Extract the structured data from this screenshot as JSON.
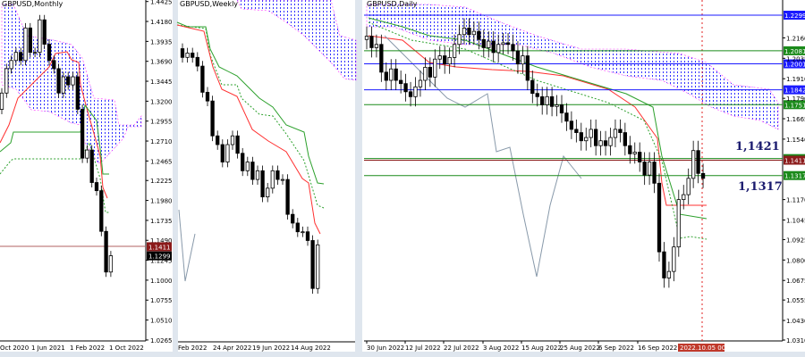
{
  "chart_data": [
    {
      "type": "candlestick",
      "title": "GBPUSD,Monthly",
      "y_ticks": [
        "1.4425",
        "1.4180",
        "1.3935",
        "1.3690",
        "1.3445",
        "1.3200",
        "1.2955",
        "1.2710",
        "1.2465",
        "1.2225",
        "1.1980",
        "1.1735",
        "1.1490",
        "1.1245",
        "1.1000",
        "1.0755",
        "1.0510",
        "1.0265"
      ],
      "x_ticks": [
        "Oct 2020",
        "1 Jun 2021",
        "1 Feb 2022",
        "1 Oct 2022"
      ],
      "closes": [
        1.33,
        1.36,
        1.37,
        1.38,
        1.37,
        1.41,
        1.38,
        1.38,
        1.42,
        1.39,
        1.37,
        1.36,
        1.33,
        1.35,
        1.34,
        1.35,
        1.31,
        1.25,
        1.26,
        1.22,
        1.21,
        1.16,
        1.11,
        1.13
      ],
      "price_labels": [
        {
          "value": "1.1411",
          "color": "#8b1a1a"
        },
        {
          "value": "1.1299",
          "color": "#000000"
        }
      ],
      "ylim": [
        1.0265,
        1.4425
      ]
    },
    {
      "type": "candlestick",
      "title": "GBPUSD,Weekly",
      "x_ticks": [
        "Feb 2022",
        "24 Apr 2022",
        "19 Jun 2022",
        "14 Aug 2022"
      ],
      "closes": [
        1.35,
        1.355,
        1.35,
        1.34,
        1.31,
        1.3,
        1.26,
        1.25,
        1.23,
        1.25,
        1.26,
        1.24,
        1.22,
        1.23,
        1.21,
        1.22,
        1.19,
        1.2,
        1.22,
        1.21,
        1.21,
        1.17,
        1.16,
        1.15,
        1.15,
        1.14,
        1.085,
        1.135
      ]
    },
    {
      "type": "candlestick",
      "title": "GBPUSD,Daily",
      "y_ticks": [
        "1.2160",
        "1.2035",
        "1.1910",
        "1.1790",
        "1.1665",
        "1.1540",
        "1.1170",
        "1.1045",
        "1.0925",
        "1.0800",
        "1.0675",
        "1.0555",
        "1.0430",
        "1.0310"
      ],
      "x_ticks": [
        "30 Jun 2022",
        "12 Jul 2022",
        "22 Jul 2022",
        "3 Aug 2022",
        "15 Aug 2022",
        "25 Aug 2022",
        "6 Sep 2022",
        "16 Sep 2022"
      ],
      "cursor_label": "2022.10.05 00:00",
      "closes": [
        1.217,
        1.21,
        1.212,
        1.195,
        1.19,
        1.197,
        1.19,
        1.188,
        1.183,
        1.18,
        1.186,
        1.19,
        1.198,
        1.192,
        1.203,
        1.205,
        1.2,
        1.204,
        1.212,
        1.218,
        1.222,
        1.218,
        1.22,
        1.215,
        1.21,
        1.214,
        1.207,
        1.212,
        1.213,
        1.212,
        1.208,
        1.2,
        1.205,
        1.19,
        1.182,
        1.18,
        1.175,
        1.18,
        1.174,
        1.175,
        1.17,
        1.165,
        1.16,
        1.158,
        1.153,
        1.155,
        1.16,
        1.15,
        1.153,
        1.15,
        1.155,
        1.16,
        1.158,
        1.15,
        1.145,
        1.146,
        1.14,
        1.132,
        1.14,
        1.127,
        1.085,
        1.069,
        1.073,
        1.088,
        1.117,
        1.12,
        1.13,
        1.147,
        1.133,
        1.13
      ],
      "levels": [
        {
          "value": 1.2299,
          "label": "1.2299",
          "color": "#1a1aff"
        },
        {
          "value": 1.2081,
          "label": "1.2081",
          "color": "#1a8a1a"
        },
        {
          "value": 1.2001,
          "label": "1.2001",
          "color": "#1a1aff"
        },
        {
          "value": 1.1842,
          "label": "1.1842",
          "color": "#1a1aff"
        },
        {
          "value": 1.1751,
          "label": "1.1751",
          "color": "#1a8a1a"
        },
        {
          "value": 1.1421,
          "label": "1.1421",
          "color": "#1a8a1a"
        },
        {
          "value": 1.1411,
          "label": "1.1411",
          "color": "#8b1a1a"
        },
        {
          "value": 1.1317,
          "label": "1.1317",
          "color": "#1a8a1a"
        }
      ],
      "annotations": [
        "1,1421",
        "1,1317"
      ],
      "ylim": [
        1.031,
        1.2299
      ]
    }
  ]
}
